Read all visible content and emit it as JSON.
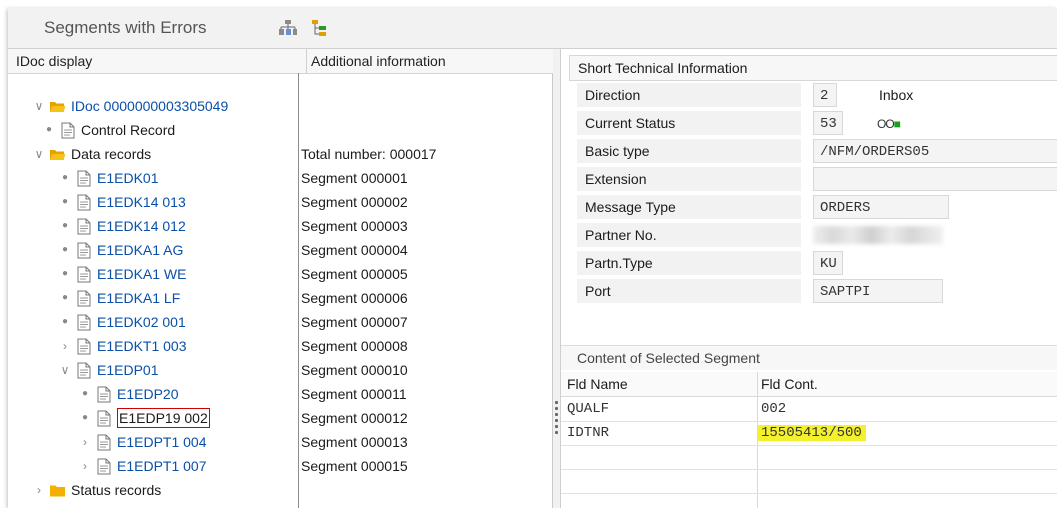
{
  "window": {
    "title": "Segments with Errors",
    "toolbar_icons": [
      "structure-icon",
      "tree-icon"
    ]
  },
  "left": {
    "col1": "IDoc display",
    "col2": "Additional information",
    "tree": [
      {
        "label": "IDoc 0000000003305049",
        "info": "",
        "icon": "folder-open-icon",
        "toggle": "expanded",
        "color": "blue"
      },
      {
        "label": "Control Record",
        "info": "",
        "icon": "document-icon",
        "toggle": "leaf",
        "color": "black"
      },
      {
        "label": "Data records",
        "info": "Total number: 000017",
        "icon": "folder-open-icon",
        "toggle": "expanded",
        "color": "black"
      },
      {
        "label": "E1EDK01",
        "info": "Segment 000001",
        "icon": "document-icon",
        "toggle": "leaf",
        "color": "blue"
      },
      {
        "label": "E1EDK14 013",
        "info": "Segment 000002",
        "icon": "document-icon",
        "toggle": "leaf",
        "color": "blue"
      },
      {
        "label": "E1EDK14 012",
        "info": "Segment 000003",
        "icon": "document-icon",
        "toggle": "leaf",
        "color": "blue"
      },
      {
        "label": "E1EDKA1 AG",
        "info": "Segment 000004",
        "icon": "document-icon",
        "toggle": "leaf",
        "color": "blue"
      },
      {
        "label": "E1EDKA1 WE",
        "info": "Segment 000005",
        "icon": "document-icon",
        "toggle": "leaf",
        "color": "blue"
      },
      {
        "label": "E1EDKA1 LF",
        "info": "Segment 000006",
        "icon": "document-icon",
        "toggle": "leaf",
        "color": "blue"
      },
      {
        "label": "E1EDK02 001",
        "info": "Segment 000007",
        "icon": "document-icon",
        "toggle": "leaf",
        "color": "blue"
      },
      {
        "label": "E1EDKT1 003",
        "info": "Segment 000008",
        "icon": "document-icon",
        "toggle": "collapsed",
        "color": "blue"
      },
      {
        "label": "E1EDP01",
        "info": "Segment 000010",
        "icon": "document-icon",
        "toggle": "expanded",
        "color": "blue"
      },
      {
        "label": "E1EDP20",
        "info": "Segment 000011",
        "icon": "document-icon",
        "toggle": "leaf",
        "color": "blue"
      },
      {
        "label": "E1EDP19 002",
        "info": "Segment 000012",
        "icon": "document-icon",
        "toggle": "leaf",
        "color": "black",
        "selected": true
      },
      {
        "label": "E1EDPT1 004",
        "info": "Segment 000013",
        "icon": "document-icon",
        "toggle": "collapsed",
        "color": "blue"
      },
      {
        "label": "E1EDPT1 007",
        "info": "Segment 000015",
        "icon": "document-icon",
        "toggle": "collapsed",
        "color": "blue"
      },
      {
        "label": "Status records",
        "info": "",
        "icon": "folder-closed-icon",
        "toggle": "collapsed",
        "color": "black"
      }
    ]
  },
  "short_info": {
    "title": "Short Technical Information",
    "rows": [
      {
        "label": "Direction",
        "value": "2",
        "extra": "Inbox"
      },
      {
        "label": "Current Status",
        "value": "53",
        "extra": "OO■"
      },
      {
        "label": "Basic type",
        "value": "/NFM/ORDERS05",
        "extra": ""
      },
      {
        "label": "Extension",
        "value": "",
        "extra": ""
      },
      {
        "label": "Message Type",
        "value": "ORDERS",
        "extra": ""
      },
      {
        "label": "Partner No.",
        "value": "",
        "extra": "",
        "blurred": true
      },
      {
        "label": "Partn.Type",
        "value": "KU",
        "extra": ""
      },
      {
        "label": "Port",
        "value": "SAPTPI",
        "extra": ""
      }
    ]
  },
  "segment": {
    "title": "Content of Selected Segment",
    "col1": "Fld Name",
    "col2": "Fld Cont.",
    "rows": [
      {
        "name": "QUALF",
        "value": "002",
        "highlight": false
      },
      {
        "name": "IDTNR",
        "value": "15505413/500",
        "highlight": true
      }
    ]
  },
  "colors": {
    "link_blue": "#0a4fa8",
    "folder": "#f5b400",
    "status_green": "#1aa01a",
    "highlight": "#f3f12e",
    "selection_border": "#d00000"
  }
}
